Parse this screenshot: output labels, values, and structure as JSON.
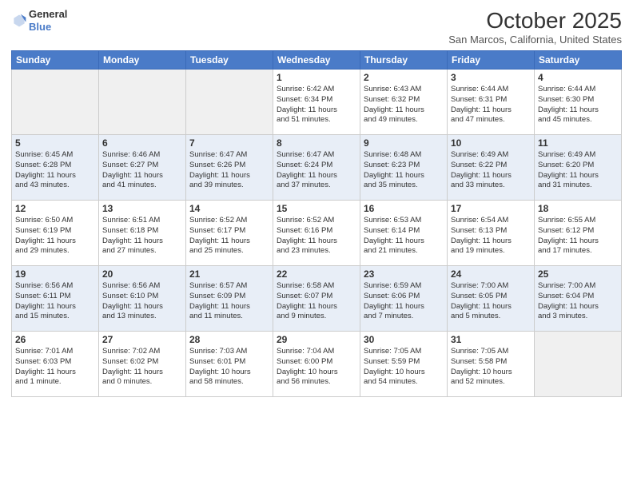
{
  "header": {
    "logo_general": "General",
    "logo_blue": "Blue",
    "title": "October 2025",
    "location": "San Marcos, California, United States"
  },
  "weekdays": [
    "Sunday",
    "Monday",
    "Tuesday",
    "Wednesday",
    "Thursday",
    "Friday",
    "Saturday"
  ],
  "weeks": [
    [
      {
        "day": "",
        "info": ""
      },
      {
        "day": "",
        "info": ""
      },
      {
        "day": "",
        "info": ""
      },
      {
        "day": "1",
        "info": "Sunrise: 6:42 AM\nSunset: 6:34 PM\nDaylight: 11 hours\nand 51 minutes."
      },
      {
        "day": "2",
        "info": "Sunrise: 6:43 AM\nSunset: 6:32 PM\nDaylight: 11 hours\nand 49 minutes."
      },
      {
        "day": "3",
        "info": "Sunrise: 6:44 AM\nSunset: 6:31 PM\nDaylight: 11 hours\nand 47 minutes."
      },
      {
        "day": "4",
        "info": "Sunrise: 6:44 AM\nSunset: 6:30 PM\nDaylight: 11 hours\nand 45 minutes."
      }
    ],
    [
      {
        "day": "5",
        "info": "Sunrise: 6:45 AM\nSunset: 6:28 PM\nDaylight: 11 hours\nand 43 minutes."
      },
      {
        "day": "6",
        "info": "Sunrise: 6:46 AM\nSunset: 6:27 PM\nDaylight: 11 hours\nand 41 minutes."
      },
      {
        "day": "7",
        "info": "Sunrise: 6:47 AM\nSunset: 6:26 PM\nDaylight: 11 hours\nand 39 minutes."
      },
      {
        "day": "8",
        "info": "Sunrise: 6:47 AM\nSunset: 6:24 PM\nDaylight: 11 hours\nand 37 minutes."
      },
      {
        "day": "9",
        "info": "Sunrise: 6:48 AM\nSunset: 6:23 PM\nDaylight: 11 hours\nand 35 minutes."
      },
      {
        "day": "10",
        "info": "Sunrise: 6:49 AM\nSunset: 6:22 PM\nDaylight: 11 hours\nand 33 minutes."
      },
      {
        "day": "11",
        "info": "Sunrise: 6:49 AM\nSunset: 6:20 PM\nDaylight: 11 hours\nand 31 minutes."
      }
    ],
    [
      {
        "day": "12",
        "info": "Sunrise: 6:50 AM\nSunset: 6:19 PM\nDaylight: 11 hours\nand 29 minutes."
      },
      {
        "day": "13",
        "info": "Sunrise: 6:51 AM\nSunset: 6:18 PM\nDaylight: 11 hours\nand 27 minutes."
      },
      {
        "day": "14",
        "info": "Sunrise: 6:52 AM\nSunset: 6:17 PM\nDaylight: 11 hours\nand 25 minutes."
      },
      {
        "day": "15",
        "info": "Sunrise: 6:52 AM\nSunset: 6:16 PM\nDaylight: 11 hours\nand 23 minutes."
      },
      {
        "day": "16",
        "info": "Sunrise: 6:53 AM\nSunset: 6:14 PM\nDaylight: 11 hours\nand 21 minutes."
      },
      {
        "day": "17",
        "info": "Sunrise: 6:54 AM\nSunset: 6:13 PM\nDaylight: 11 hours\nand 19 minutes."
      },
      {
        "day": "18",
        "info": "Sunrise: 6:55 AM\nSunset: 6:12 PM\nDaylight: 11 hours\nand 17 minutes."
      }
    ],
    [
      {
        "day": "19",
        "info": "Sunrise: 6:56 AM\nSunset: 6:11 PM\nDaylight: 11 hours\nand 15 minutes."
      },
      {
        "day": "20",
        "info": "Sunrise: 6:56 AM\nSunset: 6:10 PM\nDaylight: 11 hours\nand 13 minutes."
      },
      {
        "day": "21",
        "info": "Sunrise: 6:57 AM\nSunset: 6:09 PM\nDaylight: 11 hours\nand 11 minutes."
      },
      {
        "day": "22",
        "info": "Sunrise: 6:58 AM\nSunset: 6:07 PM\nDaylight: 11 hours\nand 9 minutes."
      },
      {
        "day": "23",
        "info": "Sunrise: 6:59 AM\nSunset: 6:06 PM\nDaylight: 11 hours\nand 7 minutes."
      },
      {
        "day": "24",
        "info": "Sunrise: 7:00 AM\nSunset: 6:05 PM\nDaylight: 11 hours\nand 5 minutes."
      },
      {
        "day": "25",
        "info": "Sunrise: 7:00 AM\nSunset: 6:04 PM\nDaylight: 11 hours\nand 3 minutes."
      }
    ],
    [
      {
        "day": "26",
        "info": "Sunrise: 7:01 AM\nSunset: 6:03 PM\nDaylight: 11 hours\nand 1 minute."
      },
      {
        "day": "27",
        "info": "Sunrise: 7:02 AM\nSunset: 6:02 PM\nDaylight: 11 hours\nand 0 minutes."
      },
      {
        "day": "28",
        "info": "Sunrise: 7:03 AM\nSunset: 6:01 PM\nDaylight: 10 hours\nand 58 minutes."
      },
      {
        "day": "29",
        "info": "Sunrise: 7:04 AM\nSunset: 6:00 PM\nDaylight: 10 hours\nand 56 minutes."
      },
      {
        "day": "30",
        "info": "Sunrise: 7:05 AM\nSunset: 5:59 PM\nDaylight: 10 hours\nand 54 minutes."
      },
      {
        "day": "31",
        "info": "Sunrise: 7:05 AM\nSunset: 5:58 PM\nDaylight: 10 hours\nand 52 minutes."
      },
      {
        "day": "",
        "info": ""
      }
    ]
  ]
}
